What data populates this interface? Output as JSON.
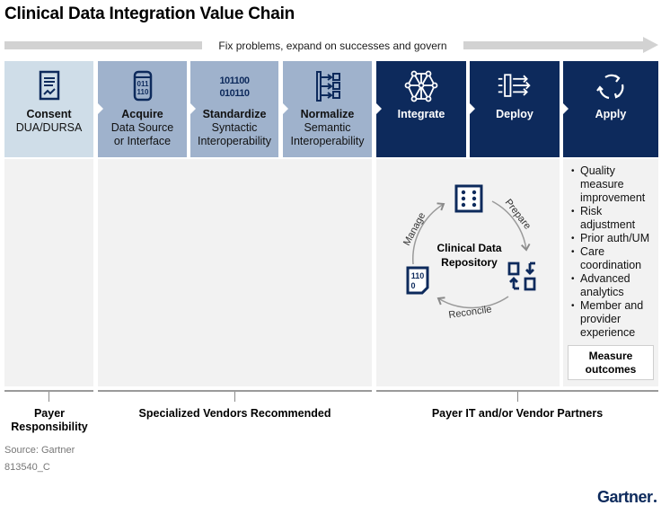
{
  "title": "Clinical Data Integration Value Chain",
  "top_arrow": {
    "label": "Fix problems, expand on successes and govern"
  },
  "stages": [
    {
      "label": "Consent",
      "sub": "DUA/DURSA",
      "icon": "signed-document-icon",
      "tone": "light"
    },
    {
      "label": "Acquire",
      "sub": "Data Source or Interface",
      "sub_lines": [
        "Data Source",
        "or Interface"
      ],
      "icon": "database-icon",
      "tone": "mid"
    },
    {
      "label": "Standardize",
      "sub_lines": [
        "Syntactic",
        "Interoperability"
      ],
      "icon": "binary-code-icon",
      "tone": "mid"
    },
    {
      "label": "Normalize",
      "sub_lines": [
        "Semantic",
        "Interoperability"
      ],
      "icon": "data-mapping-icon",
      "tone": "mid"
    },
    {
      "label": "Integrate",
      "icon": "network-mesh-icon",
      "tone": "dark"
    },
    {
      "label": "Deploy",
      "icon": "deploy-arrows-icon",
      "tone": "dark"
    },
    {
      "label": "Apply",
      "icon": "cycle-arrows-icon",
      "tone": "dark"
    }
  ],
  "cycle": {
    "center_lines": [
      "Clinical Data",
      "Repository"
    ],
    "steps": [
      "Prepare",
      "Reconcile",
      "Manage"
    ],
    "icons": [
      "data-grid-icon",
      "document-exchange-icon",
      "binary-document-icon"
    ]
  },
  "apply_outcomes": {
    "items": [
      "Quality measure improvement",
      "Risk adjustment",
      "Prior auth/UM",
      "Care coordination",
      "Advanced analytics",
      "Member and provider experience"
    ],
    "item_lines": [
      [
        "Quality",
        "measure",
        "improvement"
      ],
      [
        "Risk",
        "adjustment"
      ],
      [
        "Prior auth/UM"
      ],
      [
        "Care",
        "coordination"
      ],
      [
        "Advanced",
        "analytics"
      ],
      [
        "Member and",
        "provider",
        "experience"
      ]
    ],
    "measure_lines": [
      "Measure",
      "outcomes"
    ]
  },
  "groups": [
    {
      "lines": [
        "Payer",
        "Responsibility"
      ]
    },
    {
      "lines": [
        "Specialized Vendors Recommended"
      ]
    },
    {
      "lines": [
        "Payer IT and/or Vendor Partners"
      ]
    }
  ],
  "source": "Source: Gartner",
  "doc_id": "813540_C",
  "logo": "Gartner",
  "colors": {
    "dark_navy": "#0d2a5c",
    "mid_blue": "#9fb2cc",
    "light_blue": "#cfdde8",
    "panel_gray": "#f2f2f2",
    "arrow_gray": "#d2d2d2"
  }
}
